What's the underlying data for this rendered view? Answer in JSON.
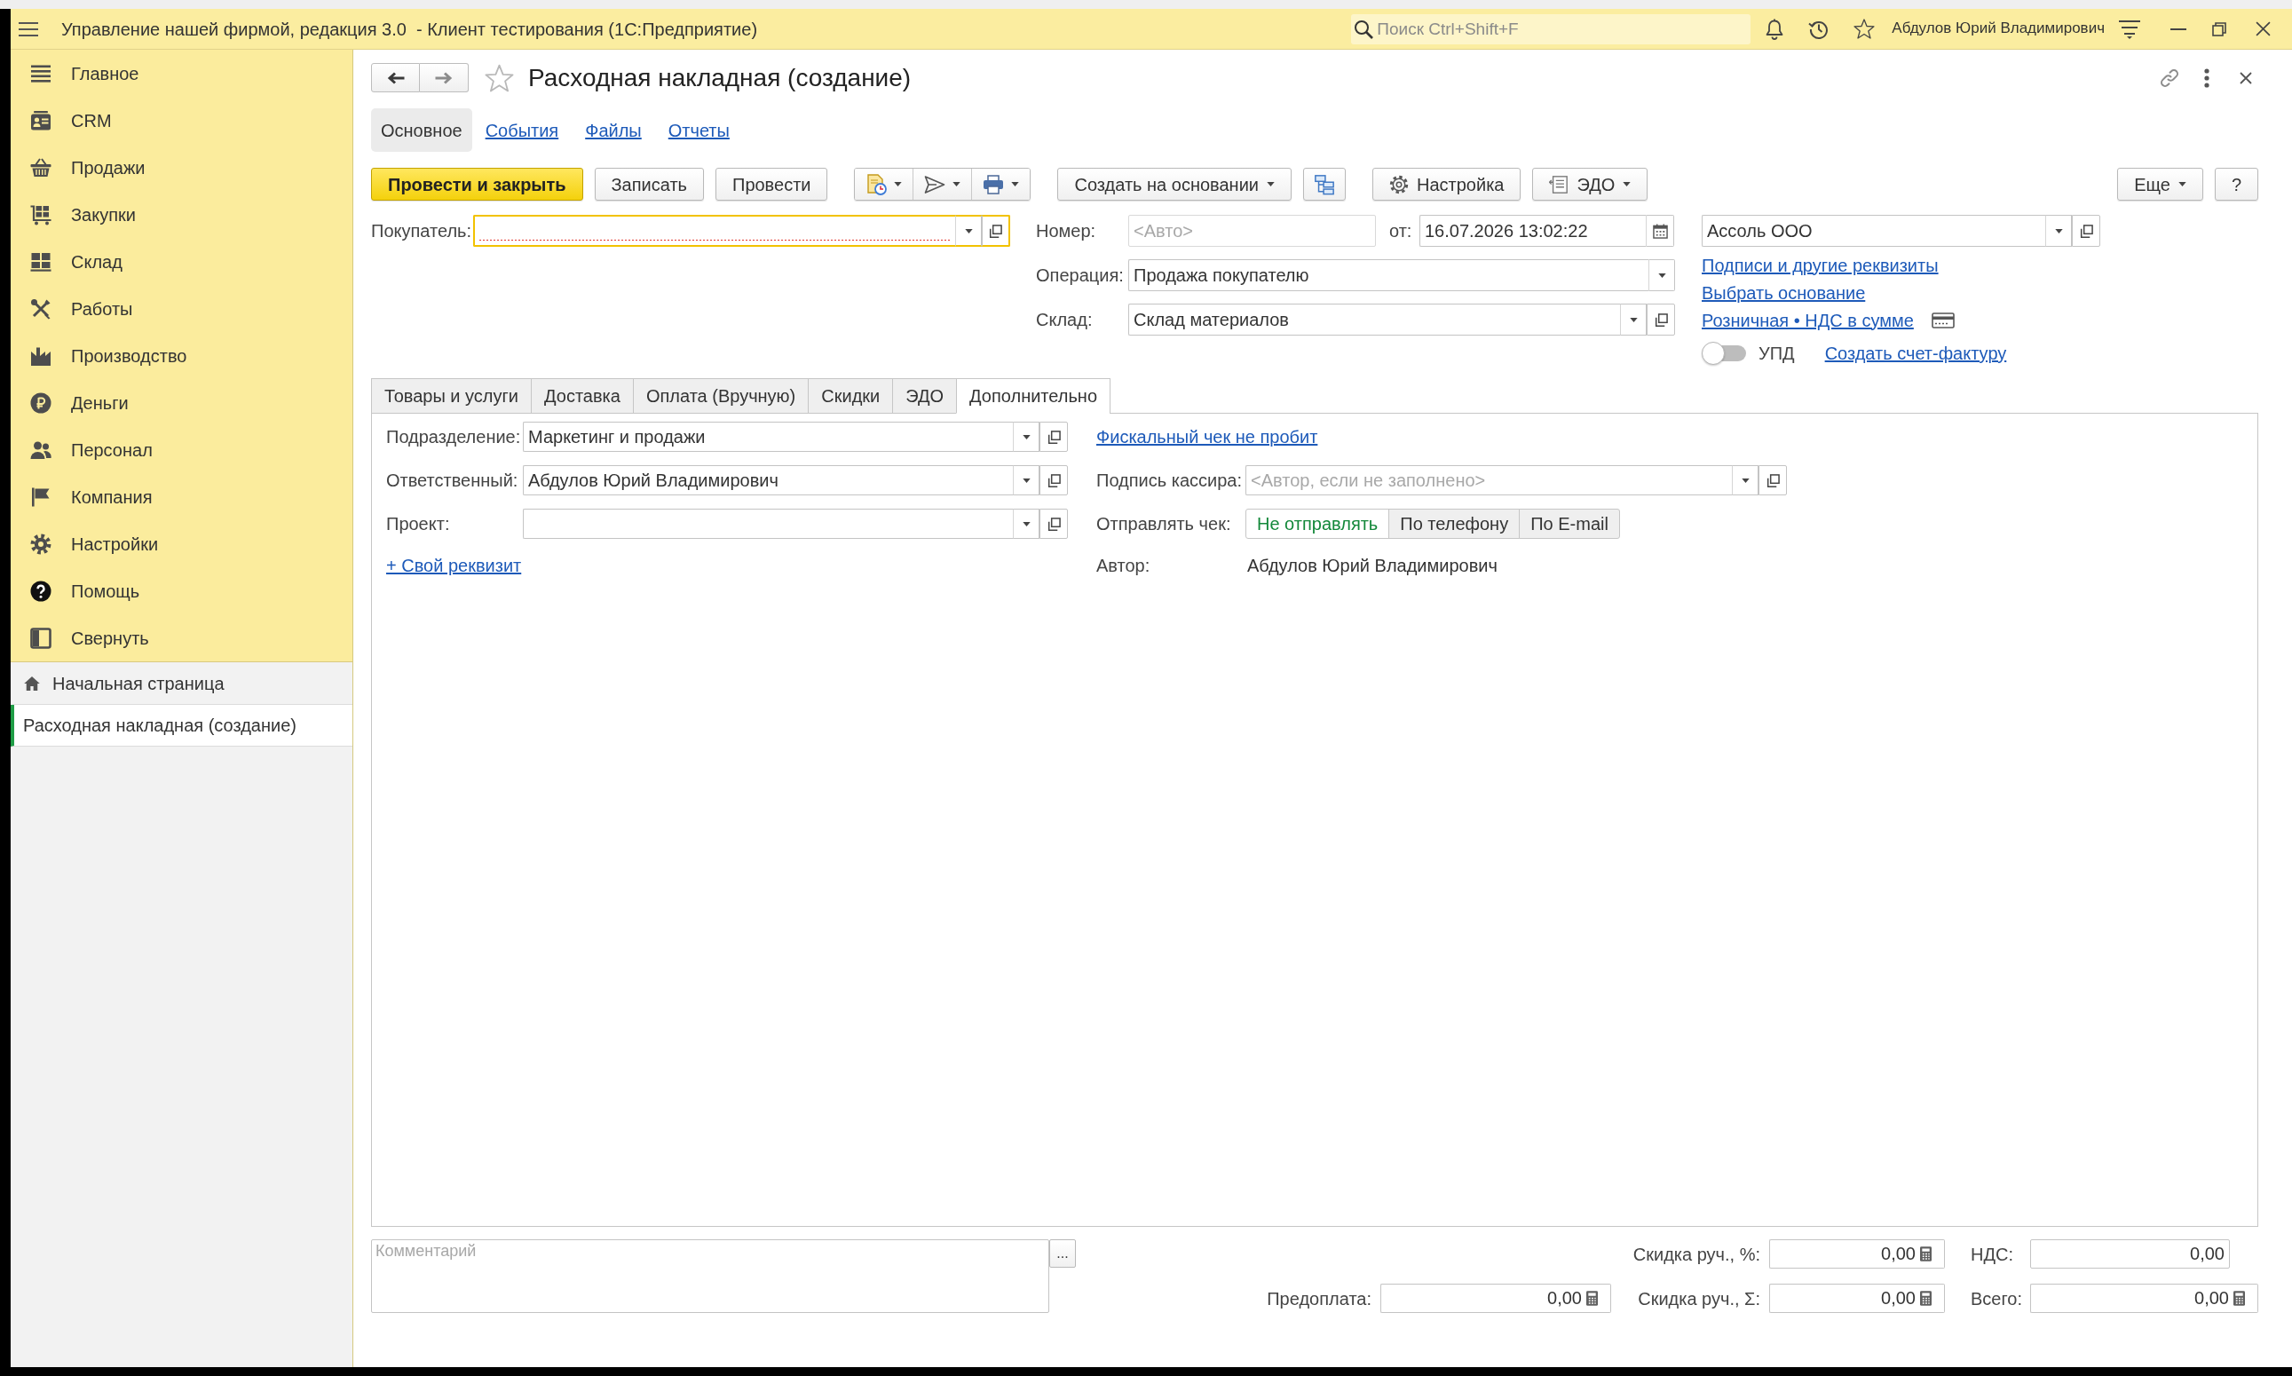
{
  "title_bar": {
    "title": "Управление нашей фирмой, редакция 3.0  - Клиент тестирования (1С:Предприятие)",
    "search": {
      "placeholder": "Поиск Ctrl+Shift+F"
    },
    "user": "Абдулов Юрий Владимирович"
  },
  "sidebar": {
    "sections": [
      {
        "label": "Главное",
        "selected": false
      },
      {
        "label": "CRM",
        "selected": false
      },
      {
        "label": "Продажи",
        "selected": false
      },
      {
        "label": "Закупки",
        "selected": false
      },
      {
        "label": "Склад",
        "selected": false
      },
      {
        "label": "Работы",
        "selected": false
      },
      {
        "label": "Производство",
        "selected": false
      },
      {
        "label": "Деньги",
        "selected": false
      },
      {
        "label": "Персонал",
        "selected": false
      },
      {
        "label": "Компания",
        "selected": false
      },
      {
        "label": "Настройки",
        "selected": false
      },
      {
        "label": "Помощь",
        "selected": false
      },
      {
        "label": "Свернуть",
        "selected": false
      }
    ],
    "open_windows": [
      {
        "label": "Начальная страница",
        "selected": false
      },
      {
        "label": "Расходная накладная (создание)",
        "selected": true
      }
    ]
  },
  "form": {
    "title": "Расходная накладная (создание)",
    "favorite": false,
    "sections": [
      {
        "label": "Основное",
        "selected": true
      },
      {
        "label": "События",
        "selected": false
      },
      {
        "label": "Файлы",
        "selected": false
      },
      {
        "label": "Отчеты",
        "selected": false
      }
    ],
    "toolbar": {
      "left": [
        {
          "kind": "button",
          "label": "Провести и закрыть",
          "default": true
        },
        {
          "kind": "button",
          "label": "Записать"
        },
        {
          "kind": "button",
          "label": "Провести"
        },
        {
          "kind": "icon_group",
          "items": [
            {
              "dropdown": true
            },
            {
              "dropdown": true
            },
            {
              "dropdown": true
            }
          ]
        },
        {
          "kind": "button",
          "label": "Создать на основании",
          "dropdown": true
        },
        {
          "kind": "icon_button"
        },
        {
          "kind": "button",
          "label": "Настройка"
        },
        {
          "kind": "button",
          "label": "ЭДО",
          "dropdown": true
        }
      ],
      "right": [
        {
          "kind": "button",
          "label": "Еще",
          "dropdown": true
        },
        {
          "kind": "button",
          "label": "?"
        }
      ]
    },
    "header": {
      "customer": {
        "label": "Покупатель:",
        "kind": "select",
        "focused": true,
        "incomplete": true
      },
      "number": {
        "label": "Номер:",
        "kind": "input",
        "placeholder": "<Авто>"
      },
      "date": {
        "label": "от:",
        "kind": "date",
        "value": "16.07.2026 13:02:22"
      },
      "operation": {
        "label": "Операция:",
        "kind": "choice",
        "value": "Продажа покупателю"
      },
      "warehouse": {
        "label": "Склад:",
        "kind": "select",
        "value": "Склад материалов"
      },
      "company": {
        "kind": "select",
        "value": "Ассоль ООО"
      },
      "links": [
        "Подписи и другие реквизиты",
        "Выбрать основание",
        "Розничная • НДС в сумме"
      ],
      "upd": {
        "label": "УПД",
        "on": false
      },
      "invoice_link": "Создать счет-фактуру"
    },
    "tabs": [
      {
        "label": "Товары и услуги",
        "selected": false
      },
      {
        "label": "Доставка",
        "selected": false
      },
      {
        "label": "Оплата (Вручную)",
        "selected": false
      },
      {
        "label": "Скидки",
        "selected": false
      },
      {
        "label": "ЭДО",
        "selected": false
      },
      {
        "label": "Дополнительно",
        "selected": true
      }
    ],
    "tab_content": {
      "fields": [
        {
          "label": "Подразделение:",
          "kind": "select",
          "value": "Маркетинг и продажи"
        },
        {
          "label": "Ответственный:",
          "kind": "select",
          "value": "Абдулов Юрий Владимирович"
        },
        {
          "label": "Проект:",
          "kind": "select"
        }
      ],
      "add_link": "+ Свой реквизит",
      "fiscal_link": "Фискальный чек не пробит",
      "cashier": {
        "label": "Подпись кассира:",
        "kind": "select",
        "placeholder": "<Автор, если не заполнено>"
      },
      "send_receipt": {
        "label": "Отправлять чек:",
        "options": [
          {
            "label": "Не отправлять",
            "selected": true
          },
          {
            "label": "По телефону",
            "selected": false
          },
          {
            "label": "По E-mail",
            "selected": false
          }
        ]
      },
      "author": {
        "label": "Автор:",
        "value": "Абдулов Юрий Владимирович"
      }
    },
    "footer": {
      "comment": {
        "placeholder": "Комментарий"
      },
      "comment_button": "...",
      "discount_percent": {
        "label": "Скидка руч., %:",
        "kind": "number",
        "value": "0,00"
      },
      "vat": {
        "label": "НДС:",
        "kind": "output",
        "value": "0,00"
      },
      "prepayment": {
        "label": "Предоплата:",
        "kind": "number",
        "value": "0,00"
      },
      "discount_sum": {
        "label": "Скидка руч., Σ:",
        "kind": "number",
        "value": "0,00"
      },
      "total": {
        "label": "Всего:",
        "kind": "number",
        "value": "0,00"
      }
    }
  }
}
